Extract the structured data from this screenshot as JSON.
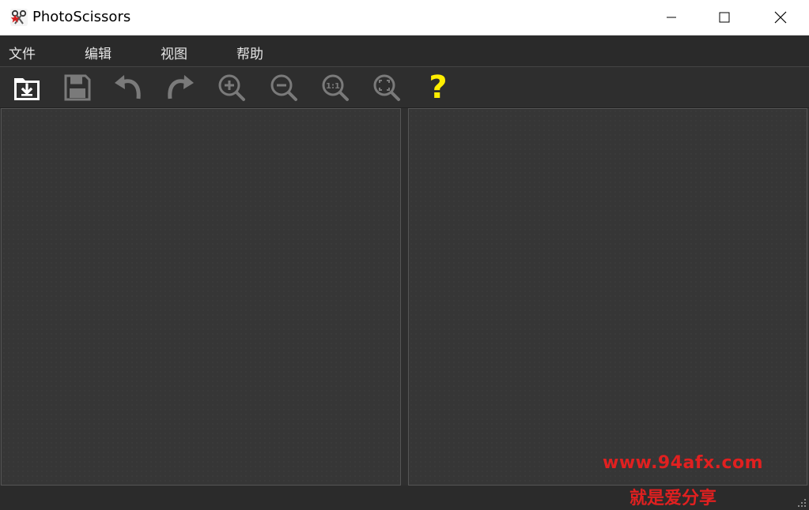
{
  "window": {
    "title": "PhotoScissors"
  },
  "menu": {
    "items": [
      {
        "label": "文件"
      },
      {
        "label": "编辑"
      },
      {
        "label": "视图"
      },
      {
        "label": "帮助"
      }
    ]
  },
  "toolbar": {
    "tools": [
      {
        "icon": "open-file-icon"
      },
      {
        "icon": "save-icon"
      },
      {
        "icon": "undo-icon"
      },
      {
        "icon": "redo-icon"
      },
      {
        "icon": "zoom-in-icon"
      },
      {
        "icon": "zoom-out-icon"
      },
      {
        "icon": "zoom-actual-size-icon",
        "label": "1:1"
      },
      {
        "icon": "zoom-fit-icon"
      },
      {
        "icon": "help-icon",
        "label": "?"
      }
    ]
  },
  "colors": {
    "help_accent": "#ffee00",
    "watermark": "#e02020"
  },
  "watermark": {
    "line1": "www.94afx.com",
    "line2": "就是爱分享"
  }
}
